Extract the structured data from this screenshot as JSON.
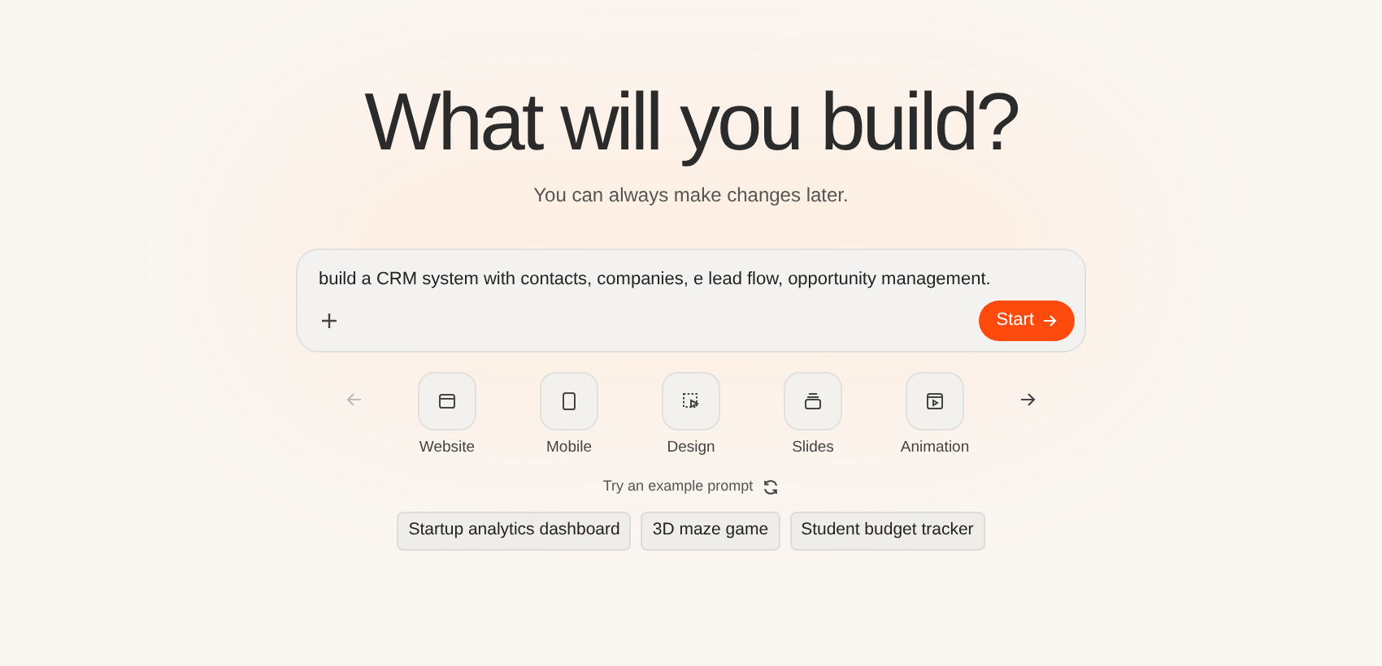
{
  "heading": "What will you build?",
  "subtitle": "You can always make changes later.",
  "prompt": {
    "value": "build a CRM system with contacts, companies, e lead flow, opportunity management.",
    "start_label": "Start"
  },
  "carousel": {
    "prev_disabled": true,
    "next_disabled": false,
    "items": [
      {
        "kind": "website",
        "label": "Website"
      },
      {
        "kind": "mobile",
        "label": "Mobile"
      },
      {
        "kind": "design",
        "label": "Design"
      },
      {
        "kind": "slides",
        "label": "Slides"
      },
      {
        "kind": "animation",
        "label": "Animation"
      }
    ]
  },
  "examples_label": "Try an example prompt",
  "examples": [
    "Startup analytics dashboard",
    "3D maze game",
    "Student budget tracker"
  ]
}
